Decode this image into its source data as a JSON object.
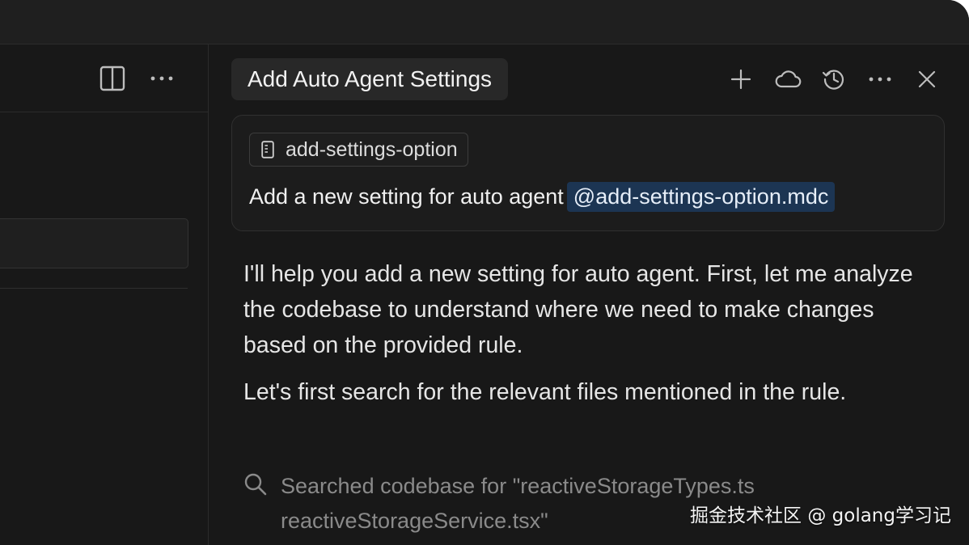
{
  "window": {
    "left_pane": {
      "toolbar": {
        "split_editor_icon": "split-editor-icon",
        "more_icon": "more-icon"
      }
    },
    "chat": {
      "tab_title": "Add Auto Agent Settings",
      "header_actions": [
        {
          "icon": "plus-icon",
          "name": "new-chat-button"
        },
        {
          "icon": "cloud-icon",
          "name": "background-agent-button"
        },
        {
          "icon": "history-icon",
          "name": "history-button"
        },
        {
          "icon": "more-icon",
          "name": "more-options-button"
        },
        {
          "icon": "close-icon",
          "name": "close-chat-button"
        }
      ],
      "prompt": {
        "context_chip": "add-settings-option",
        "context_chip_icon": "rule-file-icon",
        "text": "Add a new setting for auto agent",
        "mention": "@add-settings-option.mdc"
      },
      "response": {
        "paragraphs": [
          "I'll help you add a new setting for auto agent. First, let me analyze the codebase to understand where we need to make changes based on the provided rule.",
          "Let's first search for the relevant files mentioned in the rule."
        ]
      },
      "tool_call": {
        "icon": "search-icon",
        "text": "Searched codebase for \"reactiveStorageTypes.ts reactiveStorageService.tsx\""
      }
    }
  },
  "watermark": "掘金技术社区 @ golang学习记",
  "colors": {
    "background": "#181818",
    "panel": "#1c1c1c",
    "mention_bg": "#1c3553",
    "text": "#e6e6e6",
    "muted_text": "#8a8a8a"
  }
}
